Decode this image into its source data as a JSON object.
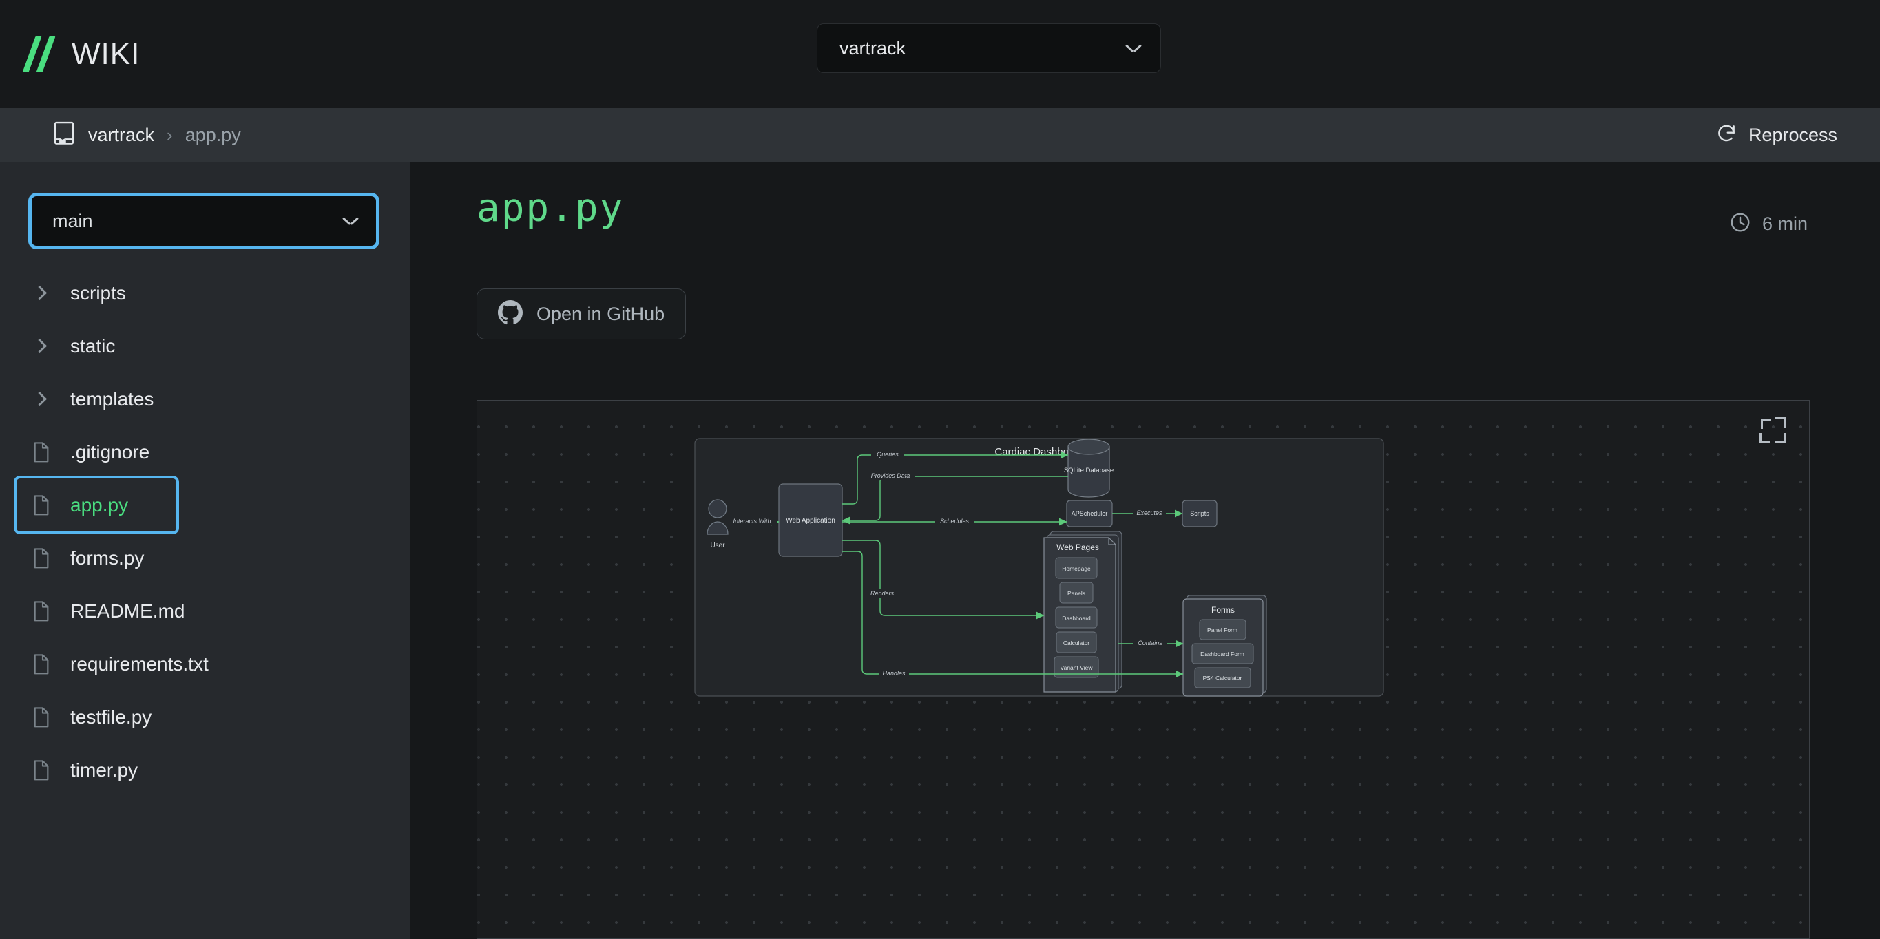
{
  "header": {
    "brand_name": "WIKI",
    "logo_icon": "double-slash-logo",
    "repo_selector": {
      "value": "vartrack",
      "icon": "chevron-down-icon"
    }
  },
  "breadcrumb": {
    "book_icon": "book-icon",
    "repo": "vartrack",
    "separator": "›",
    "file": "app.py",
    "reprocess": {
      "label": "Reprocess",
      "icon": "refresh-cw-icon"
    }
  },
  "sidebar": {
    "branch_selector": {
      "value": "main",
      "icon": "chevron-down-icon"
    },
    "items": [
      {
        "label": "scripts",
        "type": "folder",
        "icon": "chevron-right-icon",
        "selected": false
      },
      {
        "label": "static",
        "type": "folder",
        "icon": "chevron-right-icon",
        "selected": false
      },
      {
        "label": "templates",
        "type": "folder",
        "icon": "chevron-right-icon",
        "selected": false
      },
      {
        "label": ".gitignore",
        "type": "file",
        "icon": "file-icon",
        "selected": false
      },
      {
        "label": "app.py",
        "type": "file",
        "icon": "file-icon",
        "selected": true
      },
      {
        "label": "forms.py",
        "type": "file",
        "icon": "file-icon",
        "selected": false
      },
      {
        "label": "README.md",
        "type": "file",
        "icon": "file-icon",
        "selected": false
      },
      {
        "label": "requirements.txt",
        "type": "file",
        "icon": "file-icon",
        "selected": false
      },
      {
        "label": "testfile.py",
        "type": "file",
        "icon": "file-icon",
        "selected": false
      },
      {
        "label": "timer.py",
        "type": "file",
        "icon": "file-icon",
        "selected": false
      }
    ]
  },
  "main": {
    "title": "app.py",
    "read_time": {
      "label": "6 min",
      "icon": "clock-icon"
    },
    "github_button": {
      "label": "Open in GitHub",
      "icon": "github-icon"
    },
    "canvas": {
      "fit_icon": "minimize-corners-icon"
    }
  },
  "diagram": {
    "title": "Cardiac Dashboard",
    "actor": {
      "label": "User",
      "icon": "user-actor-icon"
    },
    "nodes": [
      {
        "id": "webapp",
        "label": "Web Application"
      },
      {
        "id": "sqlite",
        "label": "SQLite Database",
        "shape": "cylinder"
      },
      {
        "id": "scheduler",
        "label": "APScheduler"
      },
      {
        "id": "scripts",
        "label": "Scripts"
      }
    ],
    "groups": [
      {
        "id": "webpages",
        "label": "Web Pages",
        "children": [
          "Homepage",
          "Panels",
          "Dashboard",
          "Calculator",
          "Variant View"
        ]
      },
      {
        "id": "forms",
        "label": "Forms",
        "children": [
          "Panel Form",
          "Dashboard Form",
          "PS4 Calculator"
        ]
      }
    ],
    "edges": [
      {
        "label": "Interacts With"
      },
      {
        "label": "Queries"
      },
      {
        "label": "Provides Data"
      },
      {
        "label": "Schedules"
      },
      {
        "label": "Executes"
      },
      {
        "label": "Renders"
      },
      {
        "label": "Contains"
      },
      {
        "label": "Handles"
      }
    ],
    "edge_labels": {
      "interacts_with": "Interacts With",
      "queries": "Queries",
      "provides_data": "Provides Data",
      "schedules": "Schedules",
      "executes": "Executes",
      "renders": "Renders",
      "contains": "Contains",
      "handles": "Handles"
    },
    "webpages_children": {
      "c0": "Homepage",
      "c1": "Panels",
      "c2": "Dashboard",
      "c3": "Calculator",
      "c4": "Variant View"
    },
    "forms_children": {
      "c0": "Panel Form",
      "c1": "Dashboard Form",
      "c2": "PS4 Calculator"
    }
  },
  "colors": {
    "accent_green": "#4ade80",
    "edge_green": "#5cc97a",
    "focus_blue": "#56b6f0",
    "bg": "#16181a",
    "sidebar_bg": "#26292d",
    "crumbbar_bg": "#2f3337"
  }
}
